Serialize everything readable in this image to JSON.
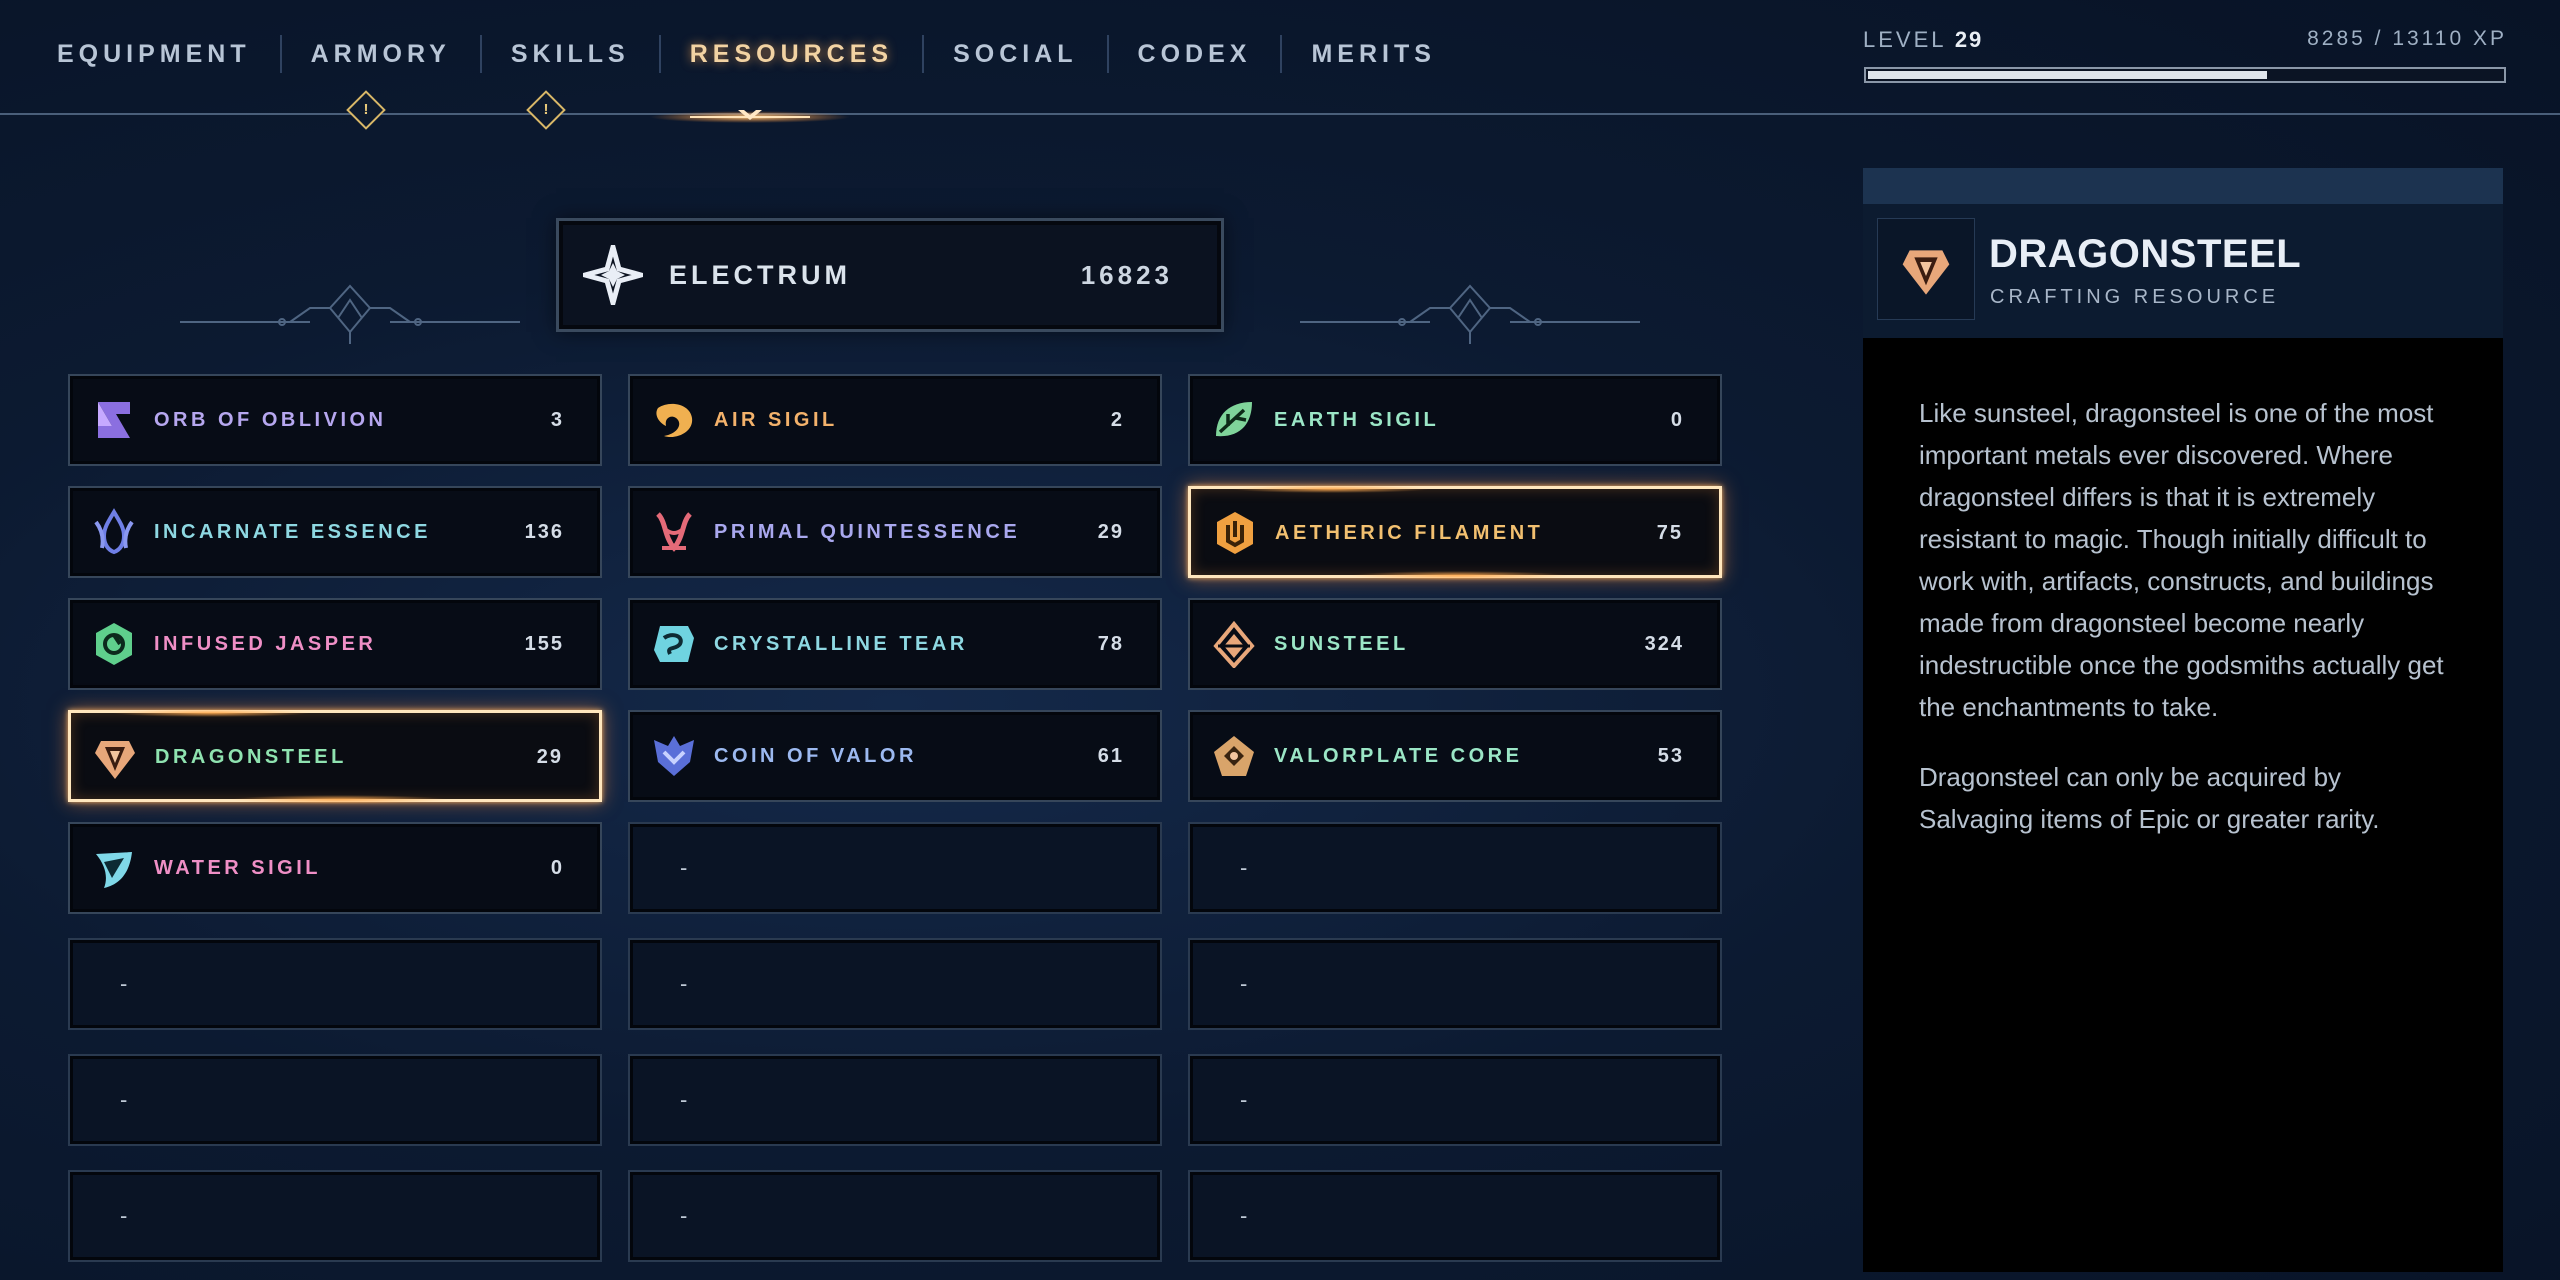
{
  "nav": {
    "tabs": [
      {
        "label": "EQUIPMENT",
        "active": false
      },
      {
        "label": "ARMORY",
        "active": false,
        "alert": "!"
      },
      {
        "label": "SKILLS",
        "active": false,
        "alert": "!"
      },
      {
        "label": "RESOURCES",
        "active": true
      },
      {
        "label": "SOCIAL",
        "active": false
      },
      {
        "label": "CODEX",
        "active": false
      },
      {
        "label": "MERITS",
        "active": false
      }
    ]
  },
  "player": {
    "level_label": "LEVEL",
    "level": "29",
    "xp_text": "8285  /  13110 XP",
    "xp_progress": 0.632
  },
  "currency": {
    "name": "ELECTRUM",
    "value": "16823",
    "icon": "electrum-star-icon"
  },
  "resources": [
    [
      {
        "name": "ORB OF OBLIVION",
        "count": "3",
        "icon": "orb-of-oblivion-icon"
      },
      {
        "name": "INCARNATE ESSENCE",
        "count": "136",
        "icon": "incarnate-essence-icon"
      },
      {
        "name": "INFUSED JASPER",
        "count": "155",
        "icon": "infused-jasper-icon"
      },
      {
        "name": "DRAGONSTEEL",
        "count": "29",
        "icon": "dragonsteel-icon",
        "selected": true
      },
      {
        "name": "WATER SIGIL",
        "count": "0",
        "icon": "water-sigil-icon"
      },
      {
        "empty": "-"
      },
      {
        "empty": "-"
      },
      {
        "empty": "-"
      }
    ],
    [
      {
        "name": "AIR SIGIL",
        "count": "2",
        "icon": "air-sigil-icon"
      },
      {
        "name": "PRIMAL QUINTESSENCE",
        "count": "29",
        "icon": "primal-quintessence-icon"
      },
      {
        "name": "CRYSTALLINE TEAR",
        "count": "78",
        "icon": "crystalline-tear-icon"
      },
      {
        "name": "COIN OF VALOR",
        "count": "61",
        "icon": "coin-of-valor-icon"
      },
      {
        "empty": "-"
      },
      {
        "empty": "-"
      },
      {
        "empty": "-"
      },
      {
        "empty": "-"
      }
    ],
    [
      {
        "name": "EARTH SIGIL",
        "count": "0",
        "icon": "earth-sigil-icon"
      },
      {
        "name": "AETHERIC FILAMENT",
        "count": "75",
        "icon": "aetheric-filament-icon",
        "highlighted": true
      },
      {
        "name": "SUNSTEEL",
        "count": "324",
        "icon": "sunsteel-icon"
      },
      {
        "name": "VALORPLATE CORE",
        "count": "53",
        "icon": "valorplate-core-icon"
      },
      {
        "empty": "-"
      },
      {
        "empty": "-"
      },
      {
        "empty": "-"
      },
      {
        "empty": "-"
      }
    ]
  ],
  "detail": {
    "title": "DRAGONSTEEL",
    "subtitle": "CRAFTING RESOURCE",
    "icon": "dragonsteel-icon",
    "paragraphs": [
      "Like sunsteel, dragonsteel is one of the most important metals ever discovered. Where dragonsteel differs is that it is extremely resistant to magic. Though initially difficult to work with, artifacts, constructs, and buildings made from dragonsteel become nearly indestructible once the godsmiths actually get the enchantments to take.",
      "Dragonsteel can only be acquired by Salvaging items of Epic or greater rarity."
    ]
  },
  "colors": {
    "accent_active": "#f2d3a3",
    "selection_glow": "#ff9a45",
    "panel_header": "#0c1b30"
  }
}
